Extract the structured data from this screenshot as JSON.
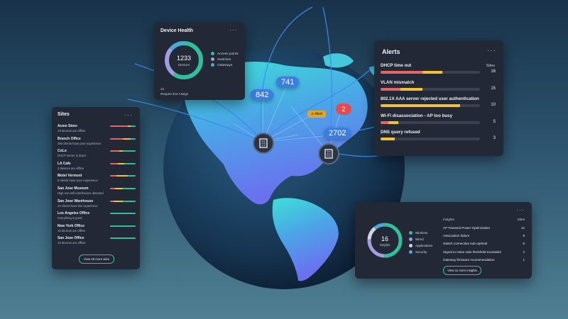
{
  "colors": {
    "red": "#e86464",
    "yellow": "#f2c230",
    "green": "#2fbf9a",
    "blue": "#3a7ee0",
    "purple": "#a59be0",
    "panel": "#232836"
  },
  "device_health": {
    "title": "Device Health",
    "menu": "···",
    "total": "1233",
    "total_label": "Devices",
    "legend": [
      {
        "label": "Access points",
        "color": "#2fbf9a"
      },
      {
        "label": "Switches",
        "color": "#a59be0"
      },
      {
        "label": "Gateways",
        "color": "#4aa8d8"
      }
    ],
    "footer_count": "12",
    "footer_text": "Require line Assign"
  },
  "sites": {
    "title": "Sites",
    "menu": "···",
    "items": [
      {
        "name": "Acme Store",
        "status": "19 devices are offline",
        "bar": [
          0.7,
          0.1,
          0.2
        ]
      },
      {
        "name": "Branch Office",
        "status": "360 clients have poor experience",
        "bar": [
          0.5,
          0.3,
          0.2
        ]
      },
      {
        "name": "CoLo",
        "status": "DHCP server is down",
        "bar": [
          0.35,
          0.15,
          0.5
        ]
      },
      {
        "name": "LA Cafe",
        "status": "3 devices are offline",
        "bar": [
          0.3,
          0.25,
          0.45
        ]
      },
      {
        "name": "Motel Vermont",
        "status": "5 clients have poor experience",
        "bar": [
          0.25,
          0.45,
          0.3
        ]
      },
      {
        "name": "San Jose Museum",
        "status": "High non-wifi interference detected",
        "bar": [
          0.2,
          0.3,
          0.5
        ]
      },
      {
        "name": "San Jose Warehouse",
        "status": "22 clients have fair experience",
        "bar": [
          0.15,
          0.35,
          0.5
        ]
      },
      {
        "name": "Los Angeles Office",
        "status": "Everything is good",
        "bar": [
          0,
          0,
          1
        ]
      },
      {
        "name": "New York Office",
        "status": "19 devices are offline",
        "bar": [
          0,
          0,
          1
        ]
      },
      {
        "name": "San Jose Office",
        "status": "19 devices are offline",
        "bar": [
          0,
          0,
          1
        ]
      }
    ],
    "view_more": "View 35 more sites"
  },
  "alerts": {
    "title": "Alerts",
    "menu": "···",
    "col_header": "Sites",
    "items": [
      {
        "name": "DHCP time out",
        "count": "16",
        "red": 0.42,
        "yellow": 0.2
      },
      {
        "name": "VLAN mismatch",
        "count": "15",
        "red": 0.2,
        "yellow": 0.22
      },
      {
        "name": "802.1X AAA server rejected user authentication",
        "count": "10",
        "red": 0,
        "yellow": 0.8
      },
      {
        "name": "Wi-Fi disassociation - AP too busy",
        "count": "5",
        "red": 0.08,
        "yellow": 0.1
      },
      {
        "name": "DNS query refused",
        "count": "3",
        "red": 0,
        "yellow": 0.14
      }
    ]
  },
  "insights": {
    "menu": "···",
    "total": "16",
    "total_label": "Insights",
    "col_name": "Insights",
    "col_sites": "Sites",
    "legend": [
      {
        "label": "Wireless",
        "color": "#2fbf9a"
      },
      {
        "label": "Wired",
        "color": "#a59be0"
      },
      {
        "label": "Applications",
        "color": "#cfd5df"
      },
      {
        "label": "Security",
        "color": "#4aa8d8"
      }
    ],
    "items": [
      {
        "name": "AP Transmit Power Optimization",
        "count": "12"
      },
      {
        "name": "Association failure",
        "count": "8"
      },
      {
        "name": "Switch connection sub-optimal",
        "count": "6"
      },
      {
        "name": "Signal to noise ratio threshold exceeded",
        "count": "2"
      },
      {
        "name": "Gateway firmware recommendation",
        "count": "1"
      }
    ],
    "view_more": "View 11 more insights"
  },
  "globe": {
    "bubbles": {
      "b741": "741",
      "b842": "842",
      "b2702": "2702"
    },
    "alert_label": "⚠ Alert",
    "red_count": "2"
  }
}
